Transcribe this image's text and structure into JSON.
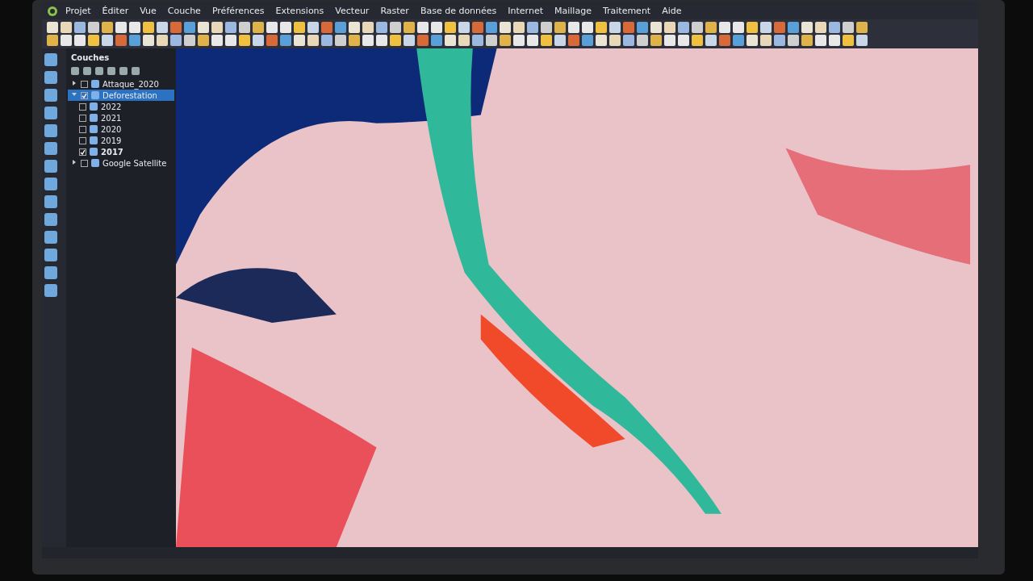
{
  "menu_bar": {
    "items": [
      "Projet",
      "Éditer",
      "Vue",
      "Couche",
      "Préférences",
      "Extensions",
      "Vecteur",
      "Raster",
      "Base de données",
      "Internet",
      "Maillage",
      "Traitement",
      "Aide"
    ]
  },
  "layers_panel": {
    "title": "Couches",
    "layers": [
      {
        "name": "Attaque_2020",
        "checked": false,
        "selected": false,
        "bold": false,
        "expanded": false
      },
      {
        "name": "Deforestation",
        "checked": true,
        "selected": true,
        "bold": false,
        "expanded": true,
        "children": [
          {
            "name": "2022",
            "checked": false,
            "selected": false,
            "bold": false
          },
          {
            "name": "2021",
            "checked": false,
            "selected": false,
            "bold": false
          },
          {
            "name": "2020",
            "checked": false,
            "selected": false,
            "bold": false
          },
          {
            "name": "2019",
            "checked": false,
            "selected": false,
            "bold": false
          },
          {
            "name": "2017",
            "checked": true,
            "selected": false,
            "bold": true
          }
        ]
      },
      {
        "name": "Google Satellite",
        "checked": false,
        "selected": false,
        "bold": false,
        "expanded": false
      }
    ]
  }
}
